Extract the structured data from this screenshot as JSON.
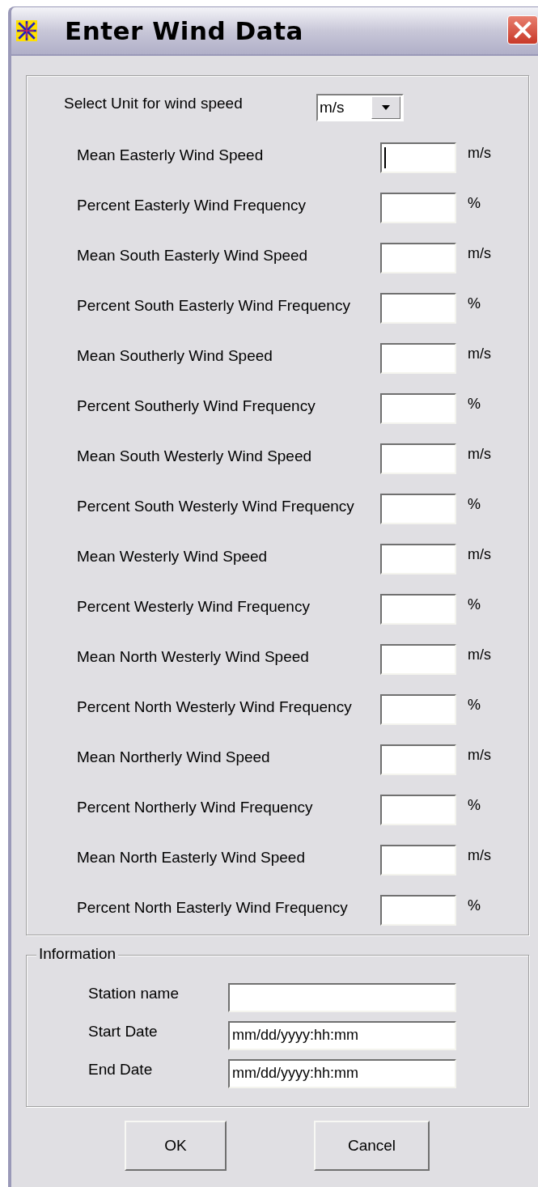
{
  "window": {
    "title": "Enter Wind Data"
  },
  "unit": {
    "label": "Select Unit for wind speed",
    "value": "m/s"
  },
  "rows": [
    {
      "label": "Mean Easterly Wind Speed",
      "unit": "m/s",
      "focused": true
    },
    {
      "label": "Percent Easterly Wind Frequency",
      "unit": "%",
      "focused": false
    },
    {
      "label": "Mean South Easterly Wind Speed",
      "unit": "m/s",
      "focused": false
    },
    {
      "label": "Percent South Easterly Wind Frequency",
      "unit": "%",
      "focused": false
    },
    {
      "label": "Mean Southerly Wind Speed",
      "unit": "m/s",
      "focused": false
    },
    {
      "label": "Percent Southerly Wind Frequency",
      "unit": "%",
      "focused": false
    },
    {
      "label": "Mean South Westerly Wind Speed",
      "unit": "m/s",
      "focused": false
    },
    {
      "label": "Percent South Westerly Wind Frequency",
      "unit": "%",
      "focused": false
    },
    {
      "label": "Mean Westerly Wind Speed",
      "unit": "m/s",
      "focused": false
    },
    {
      "label": "Percent Westerly Wind Frequency",
      "unit": "%",
      "focused": false
    },
    {
      "label": "Mean North Westerly Wind Speed",
      "unit": "m/s",
      "focused": false
    },
    {
      "label": "Percent North Westerly Wind Frequency",
      "unit": "%",
      "focused": false
    },
    {
      "label": "Mean Northerly Wind Speed",
      "unit": "m/s",
      "focused": false
    },
    {
      "label": "Percent Northerly Wind Frequency",
      "unit": "%",
      "focused": false
    },
    {
      "label": "Mean North Easterly Wind Speed",
      "unit": "m/s",
      "focused": false
    },
    {
      "label": "Percent North Easterly Wind Frequency",
      "unit": "%",
      "focused": false
    }
  ],
  "information": {
    "title": "Information",
    "fields": [
      {
        "label": "Station name"
      },
      {
        "label": "Start Date",
        "value": "mm/dd/yyyy:hh:mm"
      },
      {
        "label": "End Date",
        "value": "mm/dd/yyyy:hh:mm"
      }
    ]
  },
  "buttons": [
    "OK",
    "Cancel"
  ]
}
